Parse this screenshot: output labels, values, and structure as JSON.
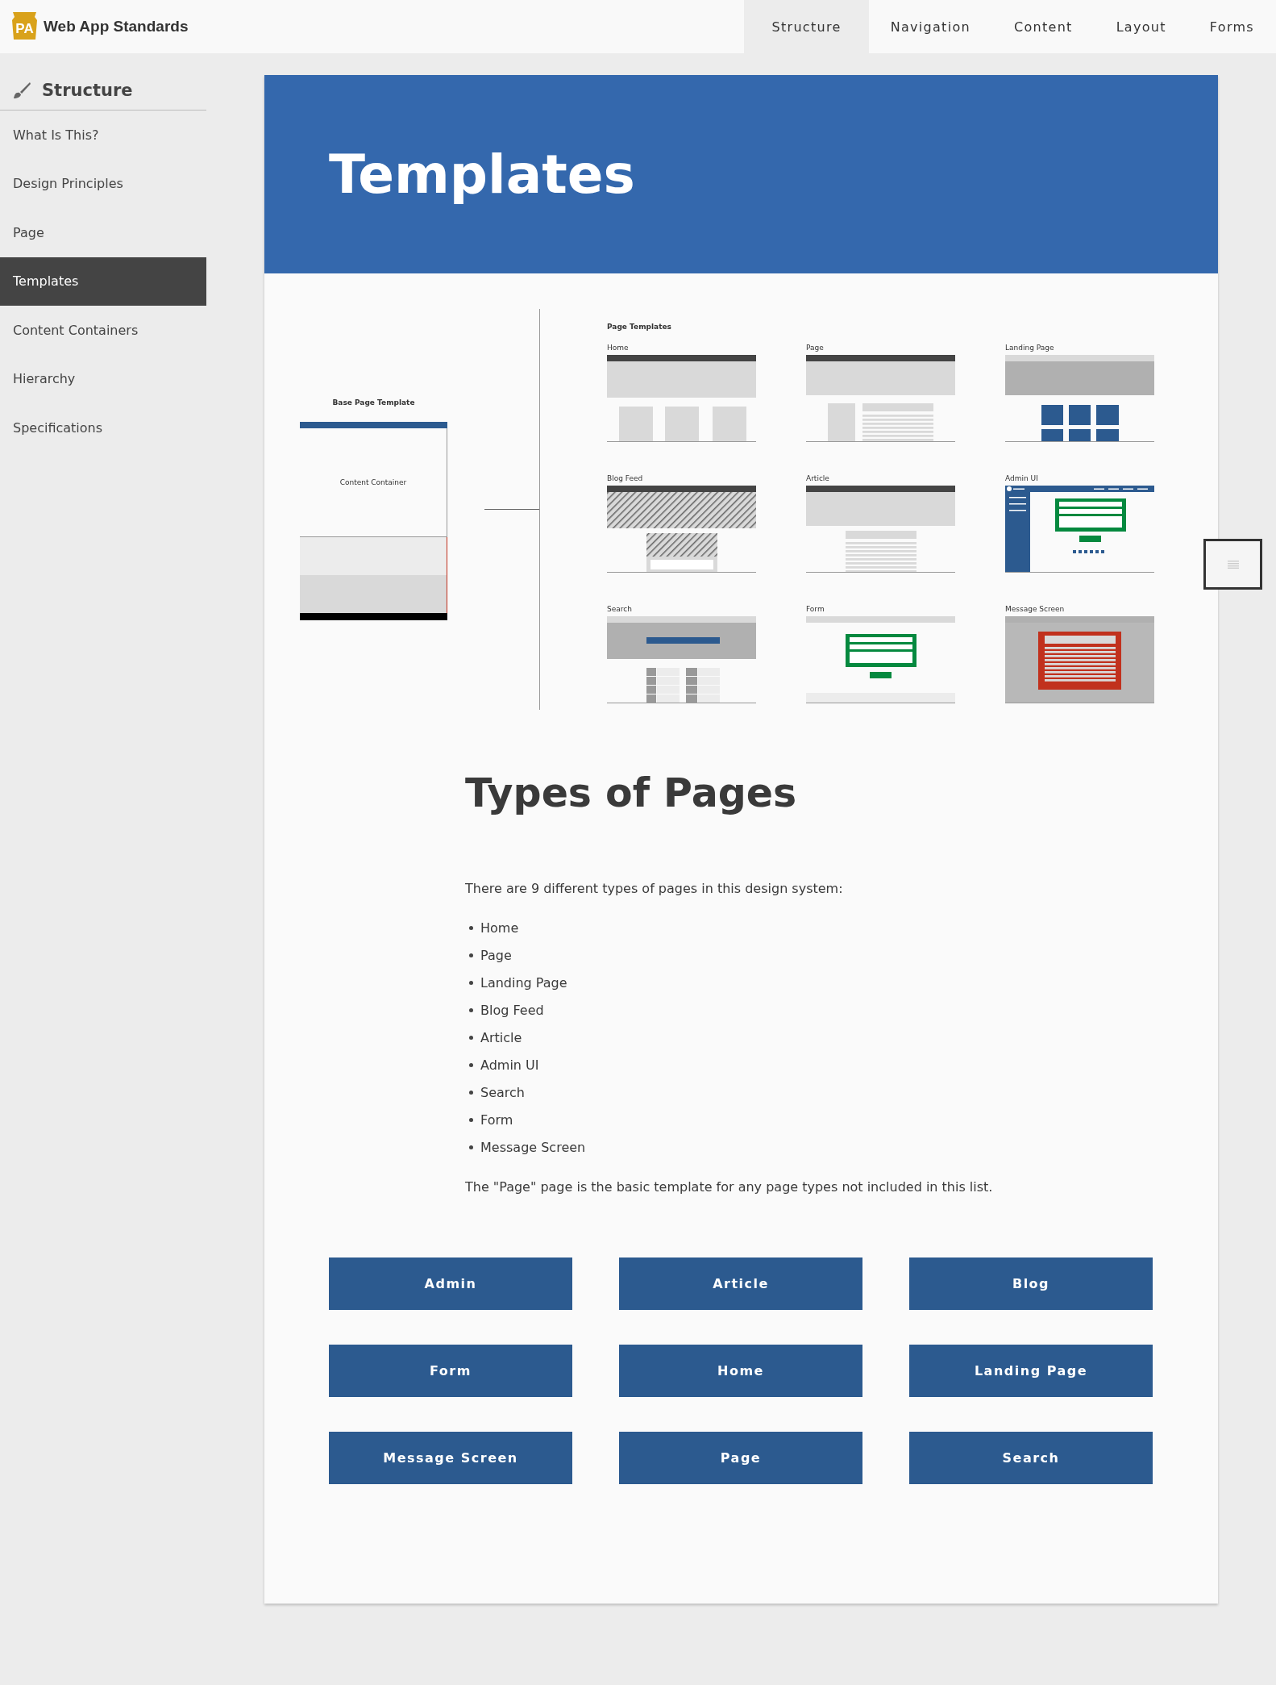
{
  "header": {
    "logo_text": "PA",
    "site_title": "Web App Standards",
    "nav": [
      {
        "label": "Structure",
        "selected": true
      },
      {
        "label": "Navigation",
        "selected": false
      },
      {
        "label": "Content",
        "selected": false
      },
      {
        "label": "Layout",
        "selected": false
      },
      {
        "label": "Forms",
        "selected": false
      }
    ]
  },
  "sidebar": {
    "heading": "Structure",
    "items": [
      {
        "label": "What Is This?",
        "selected": false
      },
      {
        "label": "Design Principles",
        "selected": false
      },
      {
        "label": "Page",
        "selected": false
      },
      {
        "label": "Templates",
        "selected": true
      },
      {
        "label": "Content Containers",
        "selected": false
      },
      {
        "label": "Hierarchy",
        "selected": false
      },
      {
        "label": "Specifications",
        "selected": false
      }
    ]
  },
  "banner": {
    "title": "Templates"
  },
  "diagram": {
    "base_title": "Base Page Template",
    "base_label": "Content Container",
    "templates_title": "Page Templates",
    "templates": [
      {
        "label": "Home",
        "kind": "home"
      },
      {
        "label": "Page",
        "kind": "page"
      },
      {
        "label": "Landing Page",
        "kind": "landing"
      },
      {
        "label": "Blog Feed",
        "kind": "blog"
      },
      {
        "label": "Article",
        "kind": "article"
      },
      {
        "label": "Admin UI",
        "kind": "admin"
      },
      {
        "label": "Search",
        "kind": "search"
      },
      {
        "label": "Form",
        "kind": "form"
      },
      {
        "label": "Message Screen",
        "kind": "message"
      }
    ]
  },
  "section": {
    "heading": "Types of Pages",
    "intro": "There are 9 different types of pages in this design system:",
    "items": [
      "Home",
      "Page",
      "Landing Page",
      "Blog Feed",
      "Article",
      "Admin UI",
      "Search",
      "Form",
      "Message Screen"
    ],
    "note": "The \"Page\" page is the basic template for any page types not included in this list."
  },
  "buttons": [
    "Admin",
    "Article",
    "Blog",
    "Form",
    "Home",
    "Landing Page",
    "Message Screen",
    "Page",
    "Search"
  ]
}
